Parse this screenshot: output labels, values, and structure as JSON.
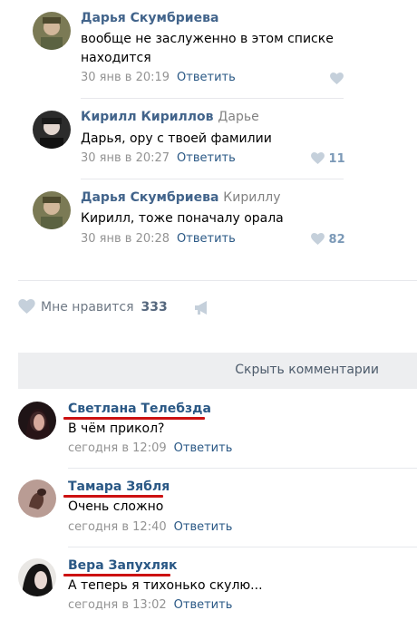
{
  "comments_top": [
    {
      "author": "Дарья Скумбриева",
      "reply_to": "",
      "text_lines": [
        "вообще не заслуженно в этом списке",
        "находится"
      ],
      "time": "30 янв в 20:19",
      "reply_label": "Ответить",
      "likes": ""
    },
    {
      "author": "Кирилл Кириллов",
      "reply_to": "Дарье",
      "text_lines": [
        "Дарья, ору с твоей фамилии"
      ],
      "time": "30 янв в 20:27",
      "reply_label": "Ответить",
      "likes": "11"
    },
    {
      "author": "Дарья Скумбриева",
      "reply_to": "Кириллу",
      "text_lines": [
        "Кирилл, тоже поначалу орала"
      ],
      "time": "30 янв в 20:28",
      "reply_label": "Ответить",
      "likes": "82"
    }
  ],
  "post_footer": {
    "like_label": "Мне нравится",
    "like_count": "333"
  },
  "hide_comments_label": "Скрыть комментарии",
  "comments_bottom": [
    {
      "author": "Светлана Телебзда",
      "text": "В чём прикол?",
      "time": "сегодня в 12:09",
      "reply_label": "Ответить"
    },
    {
      "author": "Тамара Зябля",
      "text": "Очень сложно",
      "time": "сегодня в 12:40",
      "reply_label": "Ответить"
    },
    {
      "author": "Вера Запухляк",
      "text": "А теперь я тихонько скулю...",
      "time": "сегодня в 13:02",
      "reply_label": "Ответить"
    }
  ],
  "colors": {
    "link": "#2a5885",
    "author": "#42648b",
    "meta": "#939393",
    "underline": "#cc1111",
    "like_icon": "#c5d0db"
  }
}
